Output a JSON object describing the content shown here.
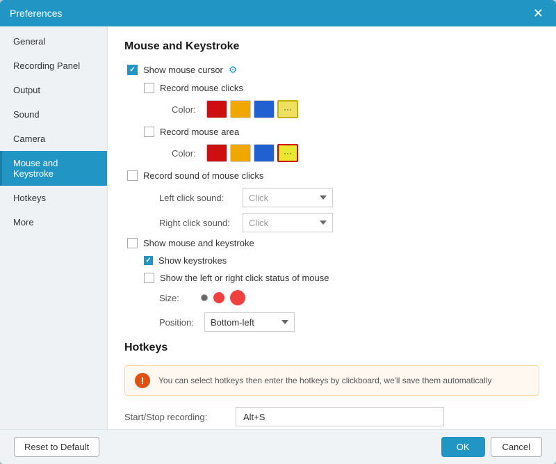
{
  "dialog": {
    "title": "Preferences",
    "close_label": "✕"
  },
  "sidebar": {
    "items": [
      {
        "id": "general",
        "label": "General",
        "active": false
      },
      {
        "id": "recording-panel",
        "label": "Recording Panel",
        "active": false
      },
      {
        "id": "output",
        "label": "Output",
        "active": false
      },
      {
        "id": "sound",
        "label": "Sound",
        "active": false
      },
      {
        "id": "camera",
        "label": "Camera",
        "active": false
      },
      {
        "id": "mouse-keystroke",
        "label": "Mouse and Keystroke",
        "active": true
      },
      {
        "id": "hotkeys",
        "label": "Hotkeys",
        "active": false
      },
      {
        "id": "more",
        "label": "More",
        "active": false
      }
    ]
  },
  "mouse_keystroke": {
    "section_title": "Mouse and Keystroke",
    "show_mouse_cursor": {
      "label": "Show mouse cursor",
      "checked": true
    },
    "record_mouse_clicks": {
      "label": "Record mouse clicks",
      "checked": false
    },
    "color_label": "Color:",
    "colors1": [
      "#cc0000",
      "#f0a800",
      "#2060d0",
      "more"
    ],
    "record_mouse_area": {
      "label": "Record mouse area",
      "checked": false
    },
    "colors2": [
      "#cc0000",
      "#f0a800",
      "#2060d0",
      "more2"
    ],
    "record_sound": {
      "label": "Record sound of mouse clicks",
      "checked": false
    },
    "left_click_sound": {
      "label": "Left click sound:",
      "placeholder": "Click",
      "value": ""
    },
    "right_click_sound": {
      "label": "Right click sound:",
      "placeholder": "Click",
      "value": ""
    },
    "show_mouse_keystroke": {
      "label": "Show mouse and keystroke",
      "checked": false
    },
    "show_keystrokes": {
      "label": "Show keystrokes",
      "checked": true
    },
    "show_click_status": {
      "label": "Show the left or right click status of mouse",
      "checked": false
    },
    "size_label": "Size:",
    "position_label": "Position:",
    "position_value": "Bottom-left"
  },
  "hotkeys": {
    "section_title": "Hotkeys",
    "info_text": "You can select hotkeys then enter the hotkeys by clickboard, we'll save them automatically",
    "start_stop_label": "Start/Stop recording:",
    "start_stop_value": "Alt+S"
  },
  "footer": {
    "reset_label": "Reset to Default",
    "ok_label": "OK",
    "cancel_label": "Cancel"
  }
}
